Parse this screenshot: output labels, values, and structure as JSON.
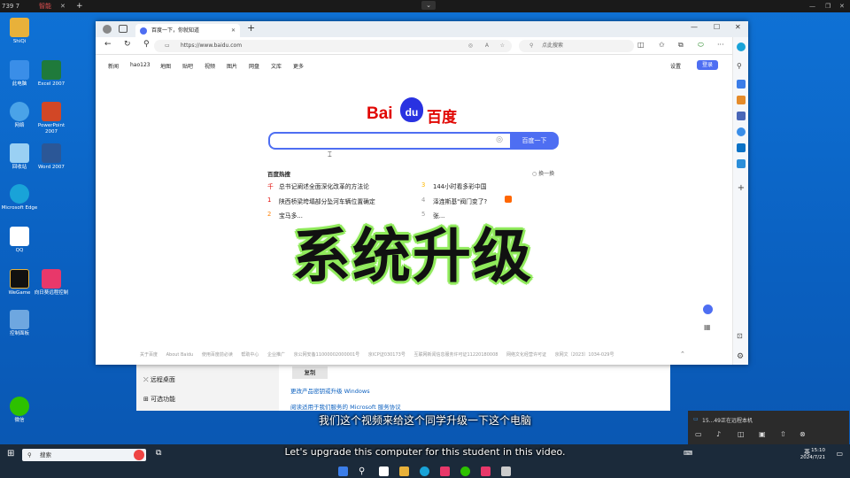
{
  "top_bar": {
    "left_text": "739 7",
    "tab_label": "智能"
  },
  "desktop_icons": [
    {
      "label": "ShiQi",
      "color": "#e8b13a"
    },
    {
      "label": "此电脑",
      "color": "#3a8ee8"
    },
    {
      "label": "Excel 2007",
      "color": "#1f7a3b"
    },
    {
      "label": "网络",
      "color": "#4aa3e8"
    },
    {
      "label": "PowerPoint 2007",
      "color": "#d24726"
    },
    {
      "label": "回收站",
      "color": "#9ad0f3"
    },
    {
      "label": "Word 2007",
      "color": "#2b5797"
    },
    {
      "label": "Microsoft Edge",
      "color": "#19a3d8"
    },
    {
      "label": "QQ",
      "color": "#ffffff"
    },
    {
      "label": "WeGame",
      "color": "#111111"
    },
    {
      "label": "向日葵远程控制",
      "color": "#e8386a"
    },
    {
      "label": "控制面板",
      "color": "#6ea7e0"
    },
    {
      "label": "微信",
      "color": "#2dc100"
    }
  ],
  "browser": {
    "tab_title": "百度一下，你就知道",
    "url": "https://www.baidu.com",
    "search_placeholder": "点此搜索",
    "nav_links": [
      "新闻",
      "hao123",
      "地图",
      "贴吧",
      "视频",
      "图片",
      "网盘",
      "文库",
      "更多"
    ],
    "settings_label": "设置",
    "login_label": "登录",
    "logo_text_left": "Bai",
    "logo_text_mid": "du",
    "logo_text_right": "百度",
    "search_button": "百度一下",
    "hot_title": "百度热搜",
    "refresh_label": "换一换",
    "hot_items_left": [
      {
        "rank": "千",
        "text": "总书记阐述全面深化改革的方法论"
      },
      {
        "rank": "1",
        "text": "陕西桥梁垮塌部分坠河车辆位置确定"
      },
      {
        "rank": "2",
        "text": "宝马多..."
      }
    ],
    "hot_items_right": [
      {
        "rank": "3",
        "text": "144小时看多彩中国"
      },
      {
        "rank": "4",
        "text": "泽连斯基\"阀门变了?"
      },
      {
        "rank": "5",
        "text": "张..."
      }
    ],
    "footer": [
      "关于百度",
      "About Baidu",
      "使用百度前必读",
      "帮助中心",
      "企业推广",
      "京公网安备11000002000001号",
      "京ICP证030173号",
      "互联网新闻信息服务许可证11220180008",
      "网络文化经营许可证",
      "京网文〔2023〕1034-029号"
    ]
  },
  "overlay_text": "系统升级",
  "settings_window": {
    "copy_button": "复制",
    "remote_desktop": "远程桌面",
    "optional_features": "可选功能",
    "link1": "更改产品密钥或升级 Windows",
    "link2": "阅读适用于我们服务的 Microsoft 服务协议"
  },
  "subtitle_cn": "我们这个视频来给这个同学升级一下这个电脑",
  "subtitle_en": "Let's upgrade this computer for this student in this video.",
  "remote_panel": {
    "status": "15...49正在远程本机"
  },
  "taskbar": {
    "search_label": "搜索",
    "time": "15:10",
    "date": "2024/7/21",
    "lang": "英"
  },
  "colors": {
    "baidu_blue": "#4e6ef2",
    "baidu_red": "#e10602",
    "overlay_glow": "#90ea5c"
  }
}
